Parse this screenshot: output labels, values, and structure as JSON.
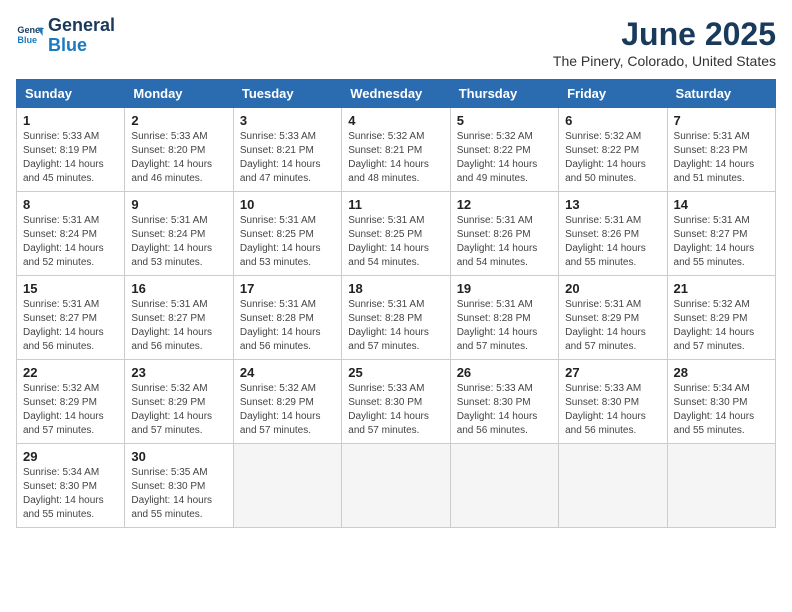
{
  "logo": {
    "line1": "General",
    "line2": "Blue"
  },
  "title": "June 2025",
  "location": "The Pinery, Colorado, United States",
  "weekdays": [
    "Sunday",
    "Monday",
    "Tuesday",
    "Wednesday",
    "Thursday",
    "Friday",
    "Saturday"
  ],
  "days": [
    {
      "num": "",
      "info": ""
    },
    {
      "num": "",
      "info": ""
    },
    {
      "num": "",
      "info": ""
    },
    {
      "num": "",
      "info": ""
    },
    {
      "num": "",
      "info": ""
    },
    {
      "num": "",
      "info": ""
    },
    {
      "num": "1",
      "info": "Sunrise: 5:33 AM\nSunset: 8:19 PM\nDaylight: 14 hours\nand 45 minutes."
    },
    {
      "num": "2",
      "info": "Sunrise: 5:33 AM\nSunset: 8:20 PM\nDaylight: 14 hours\nand 46 minutes."
    },
    {
      "num": "3",
      "info": "Sunrise: 5:33 AM\nSunset: 8:21 PM\nDaylight: 14 hours\nand 47 minutes."
    },
    {
      "num": "4",
      "info": "Sunrise: 5:32 AM\nSunset: 8:21 PM\nDaylight: 14 hours\nand 48 minutes."
    },
    {
      "num": "5",
      "info": "Sunrise: 5:32 AM\nSunset: 8:22 PM\nDaylight: 14 hours\nand 49 minutes."
    },
    {
      "num": "6",
      "info": "Sunrise: 5:32 AM\nSunset: 8:22 PM\nDaylight: 14 hours\nand 50 minutes."
    },
    {
      "num": "7",
      "info": "Sunrise: 5:31 AM\nSunset: 8:23 PM\nDaylight: 14 hours\nand 51 minutes."
    },
    {
      "num": "8",
      "info": "Sunrise: 5:31 AM\nSunset: 8:24 PM\nDaylight: 14 hours\nand 52 minutes."
    },
    {
      "num": "9",
      "info": "Sunrise: 5:31 AM\nSunset: 8:24 PM\nDaylight: 14 hours\nand 53 minutes."
    },
    {
      "num": "10",
      "info": "Sunrise: 5:31 AM\nSunset: 8:25 PM\nDaylight: 14 hours\nand 53 minutes."
    },
    {
      "num": "11",
      "info": "Sunrise: 5:31 AM\nSunset: 8:25 PM\nDaylight: 14 hours\nand 54 minutes."
    },
    {
      "num": "12",
      "info": "Sunrise: 5:31 AM\nSunset: 8:26 PM\nDaylight: 14 hours\nand 54 minutes."
    },
    {
      "num": "13",
      "info": "Sunrise: 5:31 AM\nSunset: 8:26 PM\nDaylight: 14 hours\nand 55 minutes."
    },
    {
      "num": "14",
      "info": "Sunrise: 5:31 AM\nSunset: 8:27 PM\nDaylight: 14 hours\nand 55 minutes."
    },
    {
      "num": "15",
      "info": "Sunrise: 5:31 AM\nSunset: 8:27 PM\nDaylight: 14 hours\nand 56 minutes."
    },
    {
      "num": "16",
      "info": "Sunrise: 5:31 AM\nSunset: 8:27 PM\nDaylight: 14 hours\nand 56 minutes."
    },
    {
      "num": "17",
      "info": "Sunrise: 5:31 AM\nSunset: 8:28 PM\nDaylight: 14 hours\nand 56 minutes."
    },
    {
      "num": "18",
      "info": "Sunrise: 5:31 AM\nSunset: 8:28 PM\nDaylight: 14 hours\nand 57 minutes."
    },
    {
      "num": "19",
      "info": "Sunrise: 5:31 AM\nSunset: 8:28 PM\nDaylight: 14 hours\nand 57 minutes."
    },
    {
      "num": "20",
      "info": "Sunrise: 5:31 AM\nSunset: 8:29 PM\nDaylight: 14 hours\nand 57 minutes."
    },
    {
      "num": "21",
      "info": "Sunrise: 5:32 AM\nSunset: 8:29 PM\nDaylight: 14 hours\nand 57 minutes."
    },
    {
      "num": "22",
      "info": "Sunrise: 5:32 AM\nSunset: 8:29 PM\nDaylight: 14 hours\nand 57 minutes."
    },
    {
      "num": "23",
      "info": "Sunrise: 5:32 AM\nSunset: 8:29 PM\nDaylight: 14 hours\nand 57 minutes."
    },
    {
      "num": "24",
      "info": "Sunrise: 5:32 AM\nSunset: 8:29 PM\nDaylight: 14 hours\nand 57 minutes."
    },
    {
      "num": "25",
      "info": "Sunrise: 5:33 AM\nSunset: 8:30 PM\nDaylight: 14 hours\nand 57 minutes."
    },
    {
      "num": "26",
      "info": "Sunrise: 5:33 AM\nSunset: 8:30 PM\nDaylight: 14 hours\nand 56 minutes."
    },
    {
      "num": "27",
      "info": "Sunrise: 5:33 AM\nSunset: 8:30 PM\nDaylight: 14 hours\nand 56 minutes."
    },
    {
      "num": "28",
      "info": "Sunrise: 5:34 AM\nSunset: 8:30 PM\nDaylight: 14 hours\nand 55 minutes."
    },
    {
      "num": "29",
      "info": "Sunrise: 5:34 AM\nSunset: 8:30 PM\nDaylight: 14 hours\nand 55 minutes."
    },
    {
      "num": "30",
      "info": "Sunrise: 5:35 AM\nSunset: 8:30 PM\nDaylight: 14 hours\nand 55 minutes."
    },
    {
      "num": "",
      "info": ""
    },
    {
      "num": "",
      "info": ""
    },
    {
      "num": "",
      "info": ""
    },
    {
      "num": "",
      "info": ""
    },
    {
      "num": "",
      "info": ""
    }
  ]
}
